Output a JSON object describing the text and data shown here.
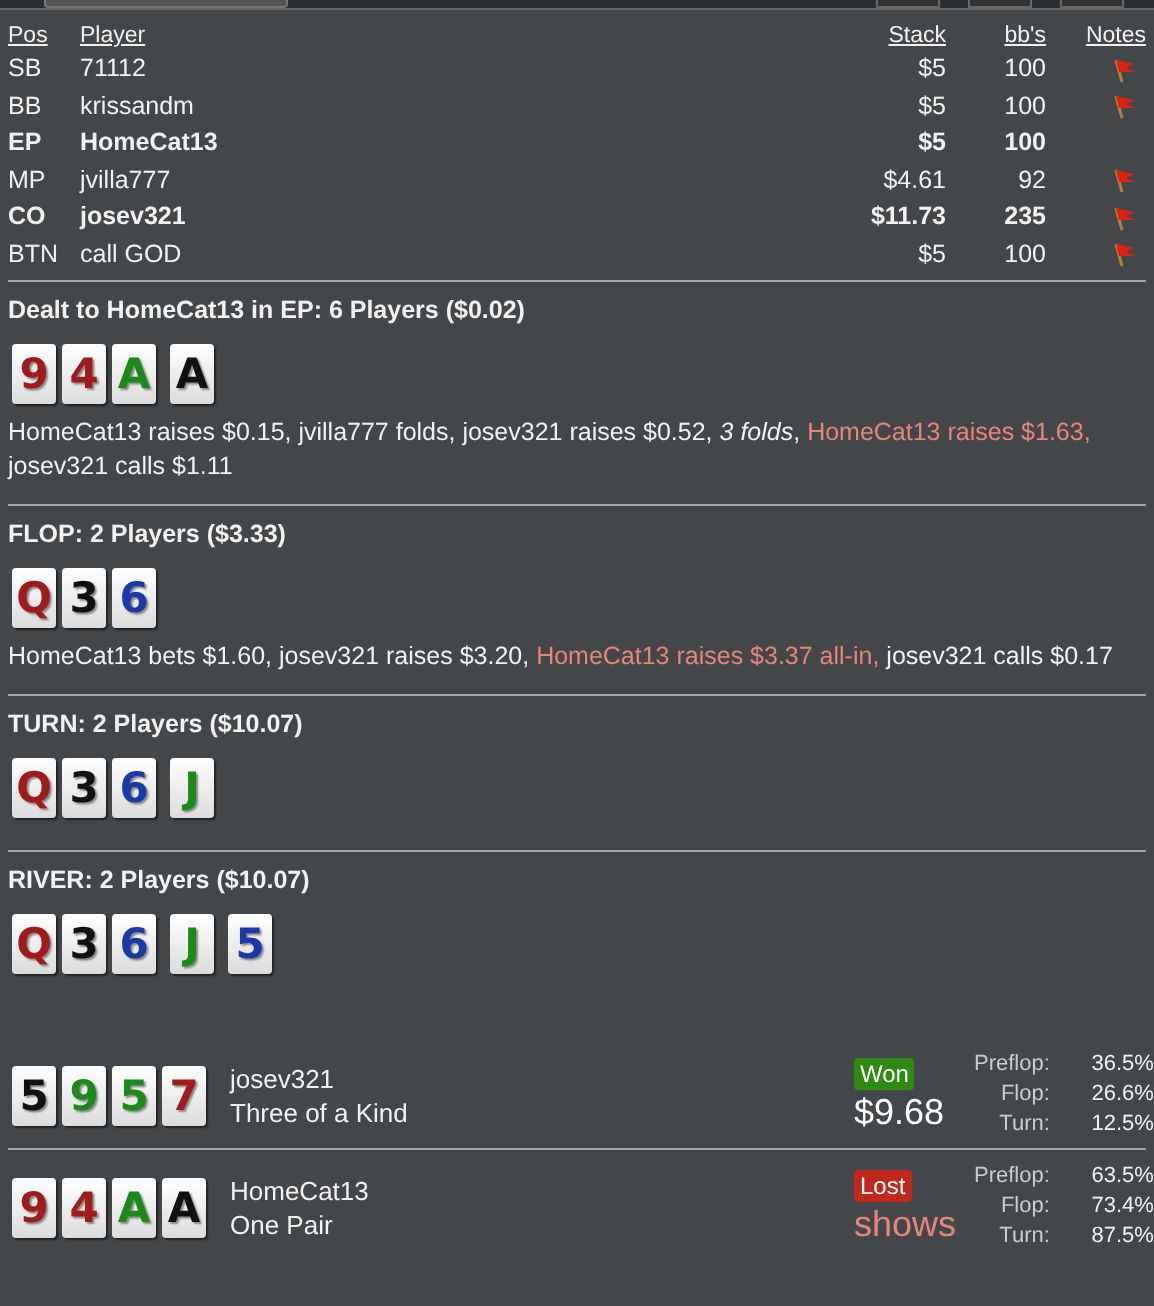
{
  "players": {
    "columns": [
      "Pos",
      "Player",
      "Stack",
      "bb's",
      "Notes"
    ],
    "rows": [
      {
        "pos": "SB",
        "name": "71112",
        "stack": "$5",
        "bbs": "100",
        "bold": false,
        "has_note": true
      },
      {
        "pos": "BB",
        "name": "krissandm",
        "stack": "$5",
        "bbs": "100",
        "bold": false,
        "has_note": true
      },
      {
        "pos": "EP",
        "name": "HomeCat13",
        "stack": "$5",
        "bbs": "100",
        "bold": true,
        "has_note": false
      },
      {
        "pos": "MP",
        "name": "jvilla777",
        "stack": "$4.61",
        "bbs": "92",
        "bold": false,
        "has_note": true
      },
      {
        "pos": "CO",
        "name": "josev321",
        "stack": "$11.73",
        "bbs": "235",
        "bold": true,
        "has_note": true
      },
      {
        "pos": "BTN",
        "name": "call GOD",
        "stack": "$5",
        "bbs": "100",
        "bold": false,
        "has_note": true
      }
    ]
  },
  "streets": [
    {
      "title": "Dealt to HomeCat13 in EP: 6 Players ($0.02)",
      "cards": [
        {
          "rank": "9",
          "color": "#a01c1c"
        },
        {
          "rank": "4",
          "color": "#a01c1c"
        },
        {
          "rank": "A",
          "color": "#1a8a1a"
        },
        {
          "rank": "A",
          "color": "#111111"
        }
      ],
      "actions": [
        {
          "kind": "plain",
          "text": "HomeCat13 raises $0.15, jvilla777 folds, josev321 raises $0.52, "
        },
        {
          "kind": "italic",
          "text": "3 folds"
        },
        {
          "kind": "plain",
          "text": ", "
        },
        {
          "kind": "hero",
          "text": "HomeCat13 raises $1.63,"
        },
        {
          "kind": "plain",
          "text": " josev321 calls $1.11"
        }
      ]
    },
    {
      "title": "FLOP: 2 Players ($3.33)",
      "cards": [
        {
          "rank": "Q",
          "color": "#a01c1c"
        },
        {
          "rank": "3",
          "color": "#111111"
        },
        {
          "rank": "6",
          "color": "#1a3aa8"
        }
      ],
      "actions": [
        {
          "kind": "plain",
          "text": "HomeCat13 bets $1.60, josev321 raises $3.20, "
        },
        {
          "kind": "hero",
          "text": "HomeCat13 raises $3.37 all-in,"
        },
        {
          "kind": "plain",
          "text": " josev321 calls $0.17"
        }
      ]
    },
    {
      "title": "TURN: 2 Players ($10.07)",
      "cards": [
        {
          "rank": "Q",
          "color": "#a01c1c"
        },
        {
          "rank": "3",
          "color": "#111111"
        },
        {
          "rank": "6",
          "color": "#1a3aa8"
        },
        {
          "rank": "J",
          "color": "#1a8a1a"
        }
      ]
    },
    {
      "title": "RIVER: 2 Players ($10.07)",
      "cards": [
        {
          "rank": "Q",
          "color": "#a01c1c"
        },
        {
          "rank": "3",
          "color": "#111111"
        },
        {
          "rank": "6",
          "color": "#1a3aa8"
        },
        {
          "rank": "J",
          "color": "#1a8a1a"
        },
        {
          "rank": "5",
          "color": "#1a3aa8"
        }
      ]
    }
  ],
  "results": [
    {
      "cards": [
        {
          "rank": "5",
          "color": "#111111"
        },
        {
          "rank": "9",
          "color": "#1a8a1a"
        },
        {
          "rank": "5",
          "color": "#1a8a1a"
        },
        {
          "rank": "7",
          "color": "#a01c1c"
        }
      ],
      "name": "josev321",
      "hand": "Three of a Kind",
      "kind": "won",
      "badge": "Won",
      "amount": "$9.68",
      "equity": [
        {
          "label": "Preflop:",
          "value": "36.5%"
        },
        {
          "label": "Flop:",
          "value": "26.6%"
        },
        {
          "label": "Turn:",
          "value": "12.5%"
        }
      ]
    },
    {
      "cards": [
        {
          "rank": "9",
          "color": "#a01c1c"
        },
        {
          "rank": "4",
          "color": "#a01c1c"
        },
        {
          "rank": "A",
          "color": "#1a8a1a"
        },
        {
          "rank": "A",
          "color": "#111111"
        }
      ],
      "name": "HomeCat13",
      "hand": "One Pair",
      "kind": "lost",
      "badge": "Lost",
      "amount": "shows",
      "equity": [
        {
          "label": "Preflop:",
          "value": "63.5%"
        },
        {
          "label": "Flop:",
          "value": "73.4%"
        },
        {
          "label": "Turn:",
          "value": "87.5%"
        }
      ]
    }
  ]
}
